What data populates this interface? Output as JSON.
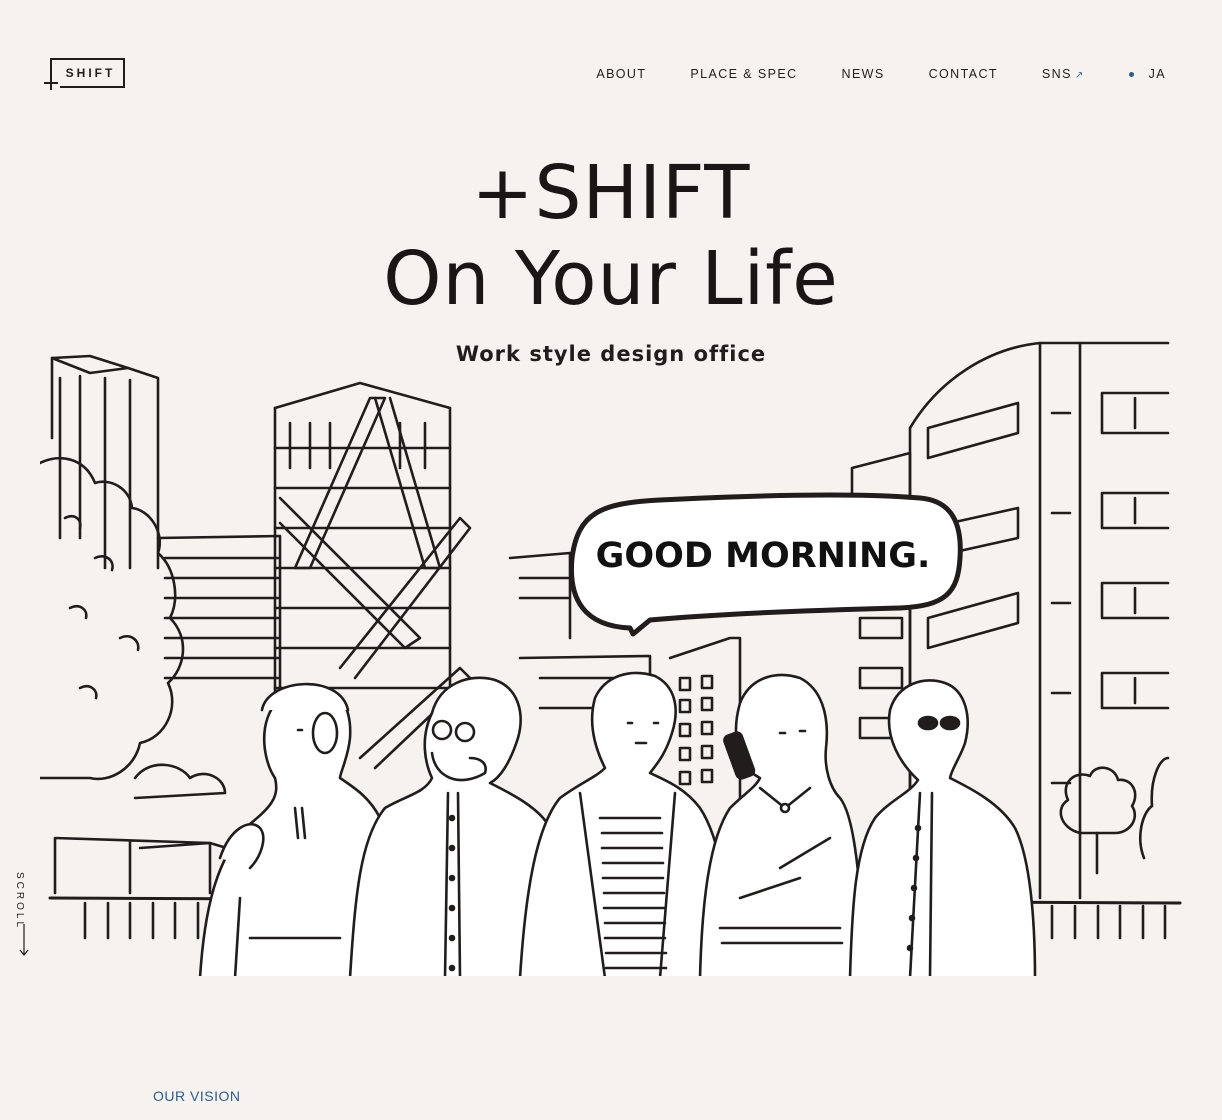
{
  "logo": {
    "text": "SHIFT"
  },
  "nav": {
    "about": "ABOUT",
    "place_spec": "PLACE & SPEC",
    "news": "NEWS",
    "contact": "CONTACT",
    "sns": "SNS",
    "sns_icon": "external-link-arrow",
    "lang": "JA"
  },
  "hero": {
    "title_line1": "+SHIFT",
    "title_line2": "On Your Life",
    "subtitle": "Work style design office",
    "speech_bubble": "GOOD MORNING."
  },
  "scroll": {
    "label": "SCROLL"
  },
  "section": {
    "vision_label": "OUR VISION"
  },
  "colors": {
    "background": "#f5f2ef",
    "ink": "#221d1d",
    "accent": "#2e5d8a"
  }
}
